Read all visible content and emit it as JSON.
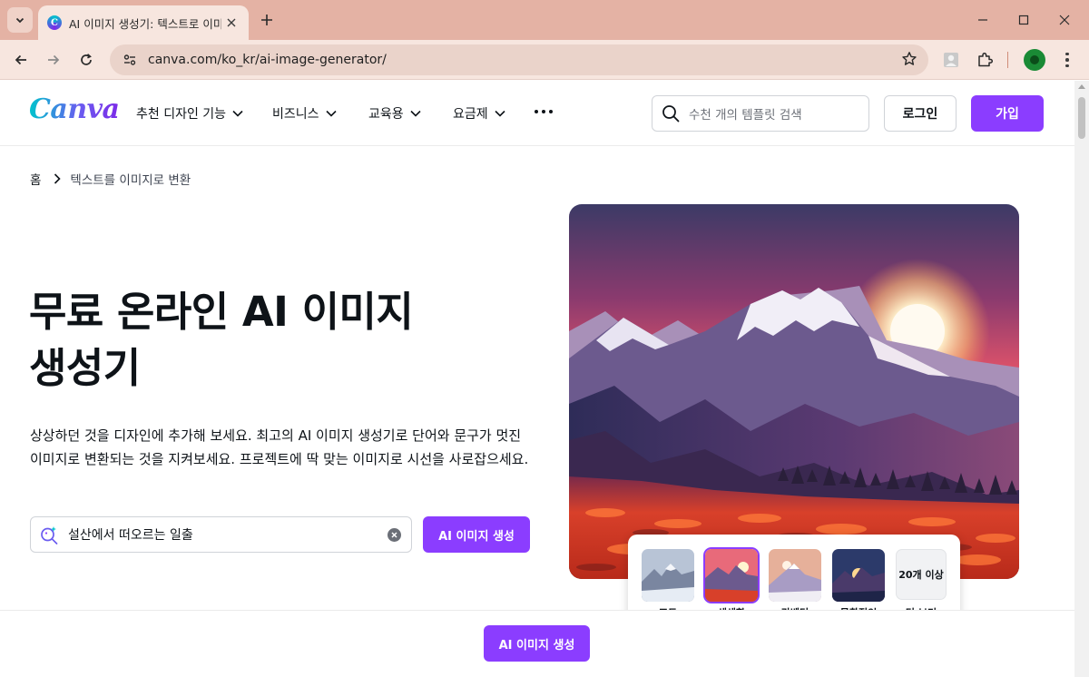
{
  "browser": {
    "tab_title": "AI 이미지 생성기: 텍스트로 이미지",
    "favicon_letter": "C",
    "url": "canva.com/ko_kr/ai-image-generator/",
    "accent": "#e4b2a4"
  },
  "header": {
    "logo": "Canva",
    "nav": [
      {
        "label": "추천 디자인 기능"
      },
      {
        "label": "비즈니스"
      },
      {
        "label": "교육용"
      },
      {
        "label": "요금제"
      }
    ],
    "search_placeholder": "수천 개의 템플릿 검색",
    "login_label": "로그인",
    "signup_label": "가입"
  },
  "breadcrumb": {
    "home": "홈",
    "current": "텍스트를 이미지로 변환"
  },
  "hero": {
    "title_line1": "무료 온라인 AI 이미지",
    "title_line2": "생성기",
    "description": "상상하던 것을 디자인에 추가해 보세요. 최고의 AI 이미지 생성기로 단어와 문구가 멋진 이미지로 변환되는 것을 지켜보세요. 프로젝트에 딱 맞는 이미지로 시선을 사로잡으세요.",
    "prompt_value": "설산에서 떠오르는 일출",
    "generate_label": "AI 이미지 생성"
  },
  "styles": {
    "options": [
      {
        "label": "포토",
        "selected": false
      },
      {
        "label": "생생함",
        "selected": true
      },
      {
        "label": "라벤더",
        "selected": false
      },
      {
        "label": "몽환적인",
        "selected": false
      }
    ],
    "more_label": "20개 이상",
    "more_caption": "더 보기"
  },
  "sticky": {
    "generate_label": "AI 이미지 생성"
  },
  "colors": {
    "brand_purple": "#8b3dff",
    "text": "#0e1318"
  }
}
